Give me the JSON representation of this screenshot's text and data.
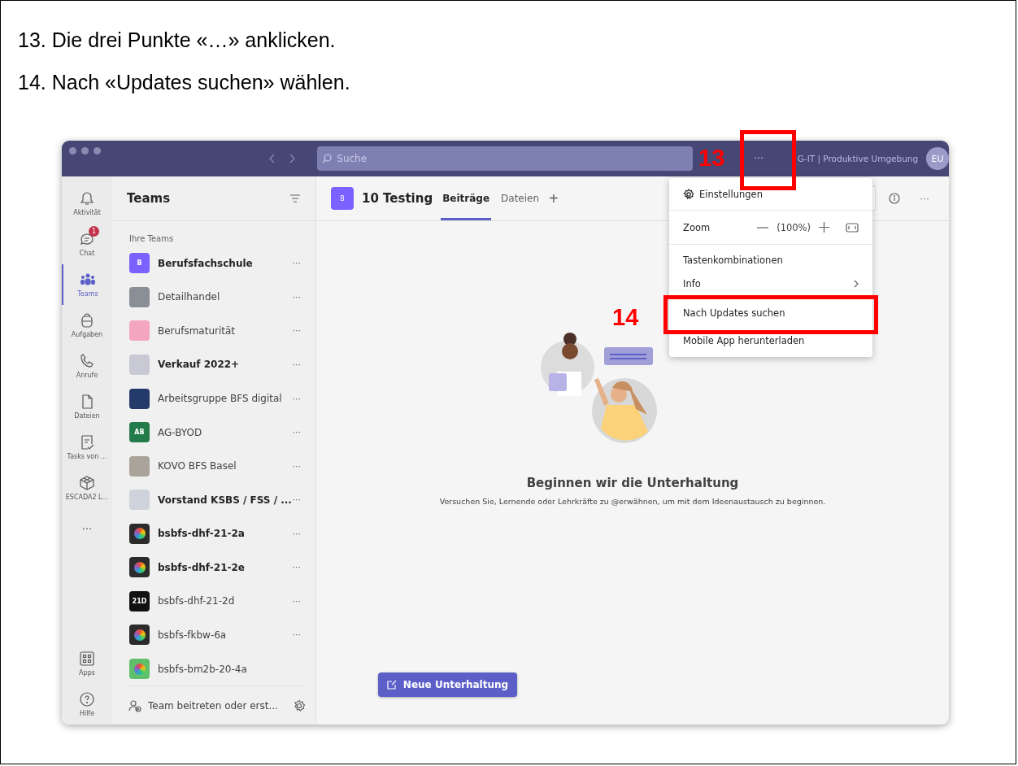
{
  "steps": [
    "13. Die drei Punkte «…» anklicken.",
    "14. Nach «Updates suchen» wählen."
  ],
  "title_bar": {
    "search_placeholder": "Suche",
    "more": "···",
    "org": "G-IT | Produktive Umgebung",
    "avatar": "EU"
  },
  "rail": {
    "items": [
      {
        "kind": "bell",
        "label": "Aktivität",
        "selected": false
      },
      {
        "kind": "chat",
        "label": "Chat",
        "selected": false,
        "badge": "1"
      },
      {
        "kind": "teams",
        "label": "Teams",
        "selected": true
      },
      {
        "kind": "bag",
        "label": "Aufgaben",
        "selected": false
      },
      {
        "kind": "phone",
        "label": "Anrufe",
        "selected": false
      },
      {
        "kind": "file",
        "label": "Dateien",
        "selected": false
      },
      {
        "kind": "tasks",
        "label": "Tasks von ...",
        "selected": false
      },
      {
        "kind": "cube",
        "label": "ESCADA2 L...",
        "selected": false
      },
      {
        "kind": "more",
        "label": "···",
        "selected": false
      }
    ],
    "bottom": [
      {
        "kind": "apps",
        "label": "Apps",
        "selected": false
      },
      {
        "kind": "help",
        "label": "Hilfe",
        "selected": false
      }
    ]
  },
  "teams_panel": {
    "title": "Teams",
    "section": "Ihre Teams",
    "teams": [
      {
        "name": "Berufsfachschule",
        "unread": true,
        "avatar": {
          "kind": "initials",
          "text": "B",
          "color": "#7b61ff"
        },
        "more": "···"
      },
      {
        "name": "Detailhandel",
        "unread": false,
        "avatar": {
          "kind": "image",
          "color": "#8a8f96"
        },
        "more": "···"
      },
      {
        "name": "Berufsmaturität",
        "unread": false,
        "avatar": {
          "kind": "image",
          "color": "#f4a6c0"
        },
        "more": "···"
      },
      {
        "name": "Verkauf 2022+",
        "unread": true,
        "avatar": {
          "kind": "image",
          "color": "#c9c9d6"
        },
        "more": "···"
      },
      {
        "name": "Arbeitsgruppe BFS digital",
        "unread": false,
        "avatar": {
          "kind": "image",
          "color": "#243a6b"
        },
        "more": "···"
      },
      {
        "name": "AG-BYOD",
        "unread": false,
        "avatar": {
          "kind": "initials",
          "text": "AB",
          "color": "#237b4b"
        },
        "more": "···"
      },
      {
        "name": "KOVO BFS Basel",
        "unread": false,
        "avatar": {
          "kind": "image",
          "color": "#a9a39a"
        },
        "more": "···"
      },
      {
        "name": "Vorstand KSBS / FSS / ...",
        "unread": true,
        "avatar": {
          "kind": "image",
          "color": "#cfd3dc"
        },
        "more": "···"
      },
      {
        "name": "bsbfs-dhf-21-2a",
        "unread": true,
        "avatar": {
          "kind": "wheel",
          "color": "#2b2b2b"
        },
        "more": "···"
      },
      {
        "name": "bsbfs-dhf-21-2e",
        "unread": true,
        "avatar": {
          "kind": "wheel",
          "color": "#2b2b2b"
        },
        "more": "···"
      },
      {
        "name": "bsbfs-dhf-21-2d",
        "unread": false,
        "avatar": {
          "kind": "initials",
          "text": "21D",
          "color": "#111111"
        },
        "more": "···"
      },
      {
        "name": "bsbfs-fkbw-6a",
        "unread": false,
        "avatar": {
          "kind": "wheel",
          "color": "#2b2b2b"
        },
        "more": "···"
      },
      {
        "name": "bsbfs-bm2b-20-4a",
        "unread": false,
        "avatar": {
          "kind": "wheel",
          "color": "#5fbf6a"
        }
      }
    ],
    "footer": "Team beitreten oder erst..."
  },
  "channel": {
    "avatar": "B",
    "name": "10 Testing",
    "tabs": [
      {
        "label": "Beiträge",
        "selected": true
      },
      {
        "label": "Dateien",
        "selected": false
      }
    ],
    "add": "+",
    "more": "···"
  },
  "empty_state": {
    "heading": "Beginnen wir die Unterhaltung",
    "text": "Versuchen Sie, Lernende oder Lehrkräfte zu @erwähnen, um mit dem Ideenaustausch zu beginnen.",
    "button": "Neue Unterhaltung"
  },
  "menu": {
    "items": [
      {
        "kind": "settings",
        "label": "Einstellungen"
      },
      {
        "kind": "zoom",
        "label": "Zoom",
        "value": "(100%)"
      },
      {
        "kind": "plain",
        "label": "Tastenkombinationen"
      },
      {
        "kind": "submenu",
        "label": "Info"
      },
      {
        "kind": "plain",
        "label": "Nach Updates suchen"
      },
      {
        "kind": "plain",
        "label": "Mobile App herunterladen"
      }
    ]
  },
  "annotations": [
    {
      "label": "13",
      "kind": "title_more"
    },
    {
      "label": "14",
      "kind": "menu_item"
    }
  ]
}
